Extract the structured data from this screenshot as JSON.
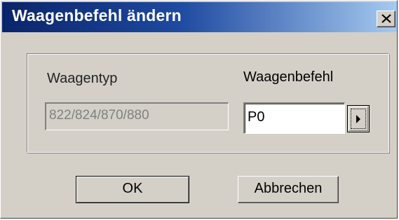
{
  "window": {
    "title": "Waagenbefehl ändern",
    "close_icon": "close-icon"
  },
  "form": {
    "waagentyp_label": "Waagentyp",
    "waagentyp_value": "822/824/870/880",
    "waagenbefehl_label": "Waagenbefehl",
    "waagenbefehl_value": "P0",
    "dropdown_icon": "arrow-right-icon"
  },
  "buttons": {
    "ok_label": "OK",
    "cancel_label": "Abbrechen"
  },
  "colors": {
    "titlebar_start": "#0a246a",
    "titlebar_end": "#a6caf0",
    "dialog_face": "#d4d0c8"
  }
}
